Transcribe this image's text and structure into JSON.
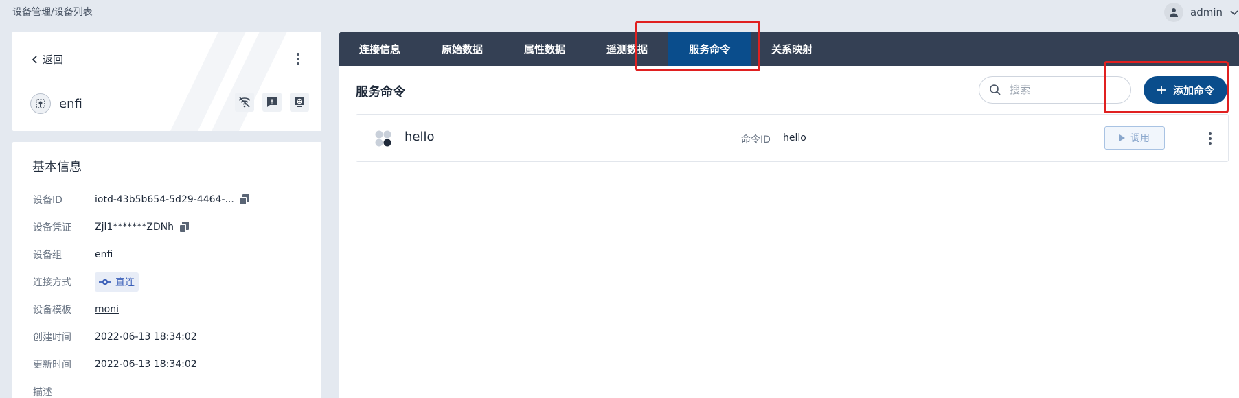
{
  "header": {
    "breadcrumb": "设备管理/设备列表",
    "username": "admin"
  },
  "device_card": {
    "back_label": "返回",
    "device_name": "enfi"
  },
  "info": {
    "title": "基本信息",
    "rows": [
      {
        "key": "设备ID",
        "value": "iotd-43b5b654-5d29-4464-..."
      },
      {
        "key": "设备凭证",
        "value": "Zjl1*******ZDNh"
      },
      {
        "key": "设备组",
        "value": "enfi"
      },
      {
        "key": "连接方式",
        "value": "直连"
      },
      {
        "key": "设备模板",
        "value": "moni"
      },
      {
        "key": "创建时间",
        "value": "2022-06-13 18:34:02"
      },
      {
        "key": "更新时间",
        "value": "2022-06-13 18:34:02"
      },
      {
        "key": "描述",
        "value": ""
      }
    ]
  },
  "tabs": [
    {
      "label": "连接信息"
    },
    {
      "label": "原始数据"
    },
    {
      "label": "属性数据"
    },
    {
      "label": "遥测数据"
    },
    {
      "label": "服务命令"
    },
    {
      "label": "关系映射"
    }
  ],
  "main": {
    "section_title": "服务命令",
    "search_placeholder": "搜索",
    "add_button_label": "添加命令",
    "commands": [
      {
        "name": "hello",
        "id_label": "命令ID",
        "id_value": "hello",
        "invoke_label": "调用"
      }
    ]
  },
  "colors": {
    "tab_bar": "#344054",
    "tab_active": "#0a4d8c",
    "primary": "#0a4d8c",
    "highlight_box": "#e02020"
  }
}
